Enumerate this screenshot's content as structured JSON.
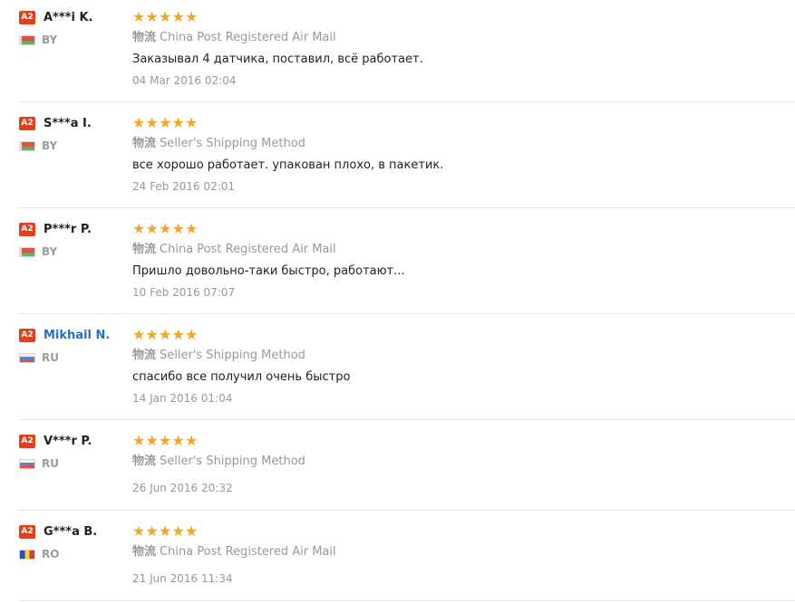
{
  "reviews": [
    {
      "level": "A2",
      "name": "A***i K.",
      "name_is_link": false,
      "country": "BY",
      "flag": "by-flag-icon",
      "stars": 5,
      "logistics_label": "物流",
      "logistics": "China Post Registered Air Mail",
      "comment": "Заказывал 4 датчика, поставил, всё работает.",
      "date": "04 Mar 2016 02:04"
    },
    {
      "level": "A2",
      "name": "S***a I.",
      "name_is_link": false,
      "country": "BY",
      "flag": "by-flag-icon",
      "stars": 5,
      "logistics_label": "物流",
      "logistics": "Seller's Shipping Method",
      "comment": "все хорошо работает. упакован плохо, в пакетик.",
      "date": "24 Feb 2016 02:01"
    },
    {
      "level": "A2",
      "name": "P***r P.",
      "name_is_link": false,
      "country": "BY",
      "flag": "by-flag-icon",
      "stars": 5,
      "logistics_label": "物流",
      "logistics": "China Post Registered Air Mail",
      "comment": "Пришло довольно-таки быстро, работают...",
      "date": "10 Feb 2016 07:07"
    },
    {
      "level": "A2",
      "name": "Mikhail N.",
      "name_is_link": true,
      "country": "RU",
      "flag": "ru-flag-icon",
      "stars": 5,
      "logistics_label": "物流",
      "logistics": "Seller's Shipping Method",
      "comment": "спасибо все получил очень быстро",
      "date": "14 Jan 2016 01:04"
    },
    {
      "level": "A2",
      "name": "V***r P.",
      "name_is_link": false,
      "country": "RU",
      "flag": "ru-flag-icon",
      "stars": 5,
      "logistics_label": "物流",
      "logistics": "Seller's Shipping Method",
      "comment": "",
      "date": "26 Jun 2016 20:32"
    },
    {
      "level": "A2",
      "name": "G***a B.",
      "name_is_link": false,
      "country": "RO",
      "flag": "ro-flag-icon",
      "stars": 5,
      "logistics_label": "物流",
      "logistics": "China Post Registered Air Mail",
      "comment": "",
      "date": "21 Jun 2016 11:34"
    }
  ],
  "colors": {
    "star": "#f5a623",
    "badge": "#e0411b",
    "link": "#2870c1"
  }
}
